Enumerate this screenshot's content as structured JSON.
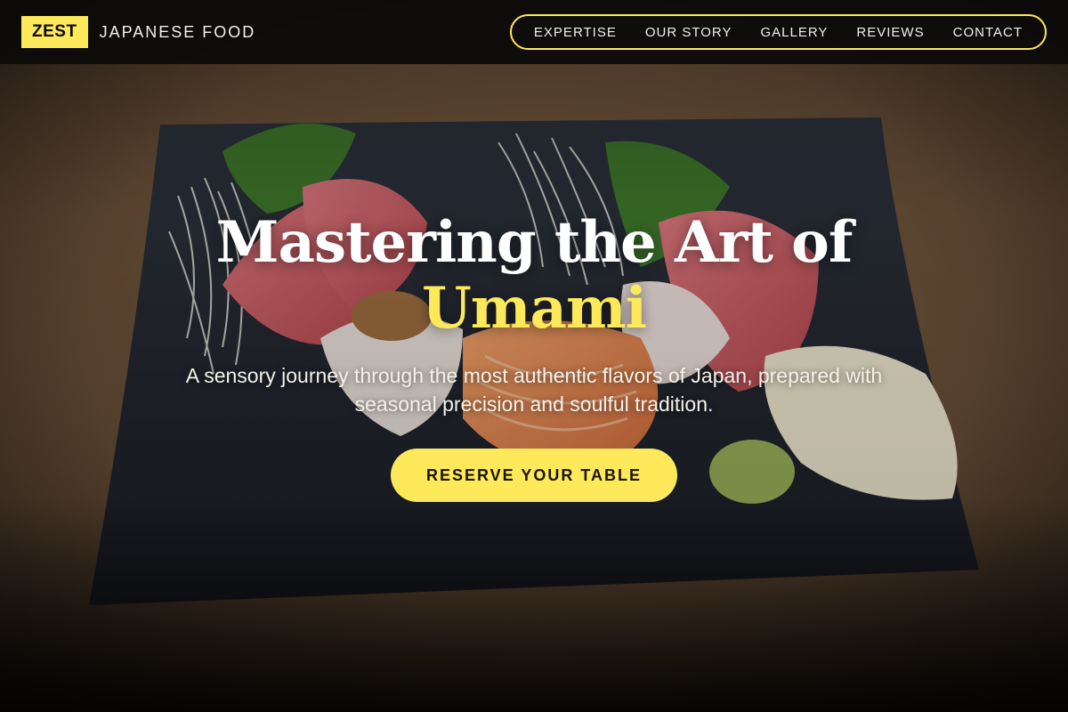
{
  "brand": {
    "badge": "ZEST",
    "name": "JAPANESE FOOD"
  },
  "nav": {
    "items": [
      {
        "label": "EXPERTISE"
      },
      {
        "label": "OUR STORY"
      },
      {
        "label": "GALLERY"
      },
      {
        "label": "REVIEWS"
      },
      {
        "label": "CONTACT"
      }
    ]
  },
  "hero": {
    "headline_line1": "Mastering the Art of",
    "headline_accent": "Umami",
    "subhead": "A sensory journey through the most authentic flavors of Japan, prepared with seasonal precision and soulful tradition.",
    "cta_label": "RESERVE YOUR TABLE",
    "background_image": "sashimi-platter-image"
  },
  "colors": {
    "accent": "#fde95a",
    "navbar_bg": "#0c0b0a",
    "text_light": "#f2f0ea"
  }
}
